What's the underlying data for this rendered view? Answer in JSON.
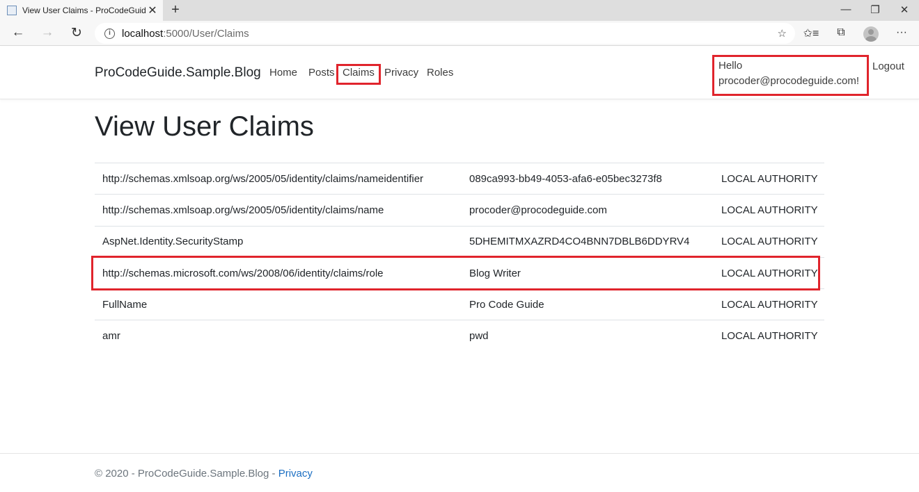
{
  "browser": {
    "tab_title": "View User Claims - ProCodeGuid",
    "tab_close": "✕",
    "new_tab": "+",
    "minimize": "—",
    "restore": "❐",
    "close": "✕",
    "back": "←",
    "forward": "→",
    "refresh": "↻",
    "info": "i",
    "url_host": "localhost",
    "url_rest": ":5000/User/Claims",
    "favorites_add": "☆",
    "favorites": "✩≡",
    "collections": "⧉",
    "more": "···"
  },
  "nav": {
    "brand": "ProCodeGuide.Sample.Blog",
    "links": [
      "Home",
      "Posts",
      "Claims",
      "Privacy",
      "Roles"
    ],
    "hello_line1": "Hello",
    "hello_line2": "procoder@procodeguide.com!",
    "logout": "Logout"
  },
  "page": {
    "title": "View User Claims"
  },
  "claims": [
    {
      "type": "http://schemas.xmlsoap.org/ws/2005/05/identity/claims/nameidentifier",
      "value": "089ca993-bb49-4053-afa6-e05bec3273f8",
      "issuer": "LOCAL AUTHORITY"
    },
    {
      "type": "http://schemas.xmlsoap.org/ws/2005/05/identity/claims/name",
      "value": "procoder@procodeguide.com",
      "issuer": "LOCAL AUTHORITY"
    },
    {
      "type": "AspNet.Identity.SecurityStamp",
      "value": "5DHEMITMXAZRD4CO4BNN7DBLB6DDYRV4",
      "issuer": "LOCAL AUTHORITY"
    },
    {
      "type": "http://schemas.microsoft.com/ws/2008/06/identity/claims/role",
      "value": "Blog Writer",
      "issuer": "LOCAL AUTHORITY"
    },
    {
      "type": "FullName",
      "value": "Pro Code Guide",
      "issuer": "LOCAL AUTHORITY"
    },
    {
      "type": "amr",
      "value": "pwd",
      "issuer": "LOCAL AUTHORITY"
    }
  ],
  "footer": {
    "text": "© 2020 - ProCodeGuide.Sample.Blog - ",
    "privacy": "Privacy"
  },
  "colors": {
    "highlight": "#e0242c",
    "link": "#1b6ec2"
  }
}
